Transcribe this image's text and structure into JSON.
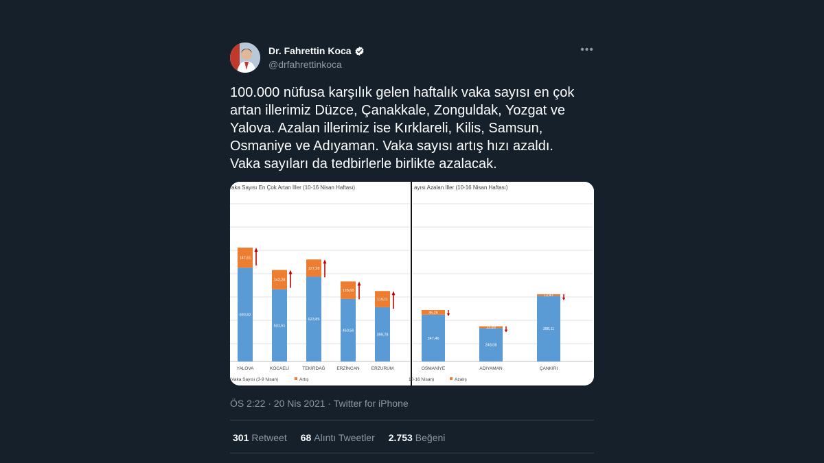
{
  "author": {
    "name": "Dr. Fahrettin Koca",
    "handle": "@drfahrettinkoca"
  },
  "tweet_text": "100.000 nüfusa karşılık gelen haftalık vaka sayısı en çok\nartan illerimiz Düzce, Çanakkale, Zonguldak, Yozgat ve\nYalova. Azalan illerimiz ise Kırklareli, Kilis, Samsun,\nOsmaniye ve Adıyaman. Vaka sayısı artış hızı azaldı.\nVaka sayıları da tedbirlerle birlikte azalacak.",
  "meta": "ÖS 2:22 · 20 Nis 2021 · Twitter for iPhone",
  "stats": {
    "retweets_count": "301",
    "retweets_label": "Retweet",
    "quotes_count": "68",
    "quotes_label": "Alıntı Tweetler",
    "likes_count": "2.753",
    "likes_label": "Beğeni"
  },
  "colors": {
    "background": "#15202b",
    "base_bar": "#5b9bd5",
    "change_bar": "#ed7d31",
    "arrow": "#c00000"
  },
  "icons": {
    "verified": "verified-badge-icon",
    "more": "more-options-icon"
  },
  "chart_data": [
    {
      "type": "bar",
      "stacked": true,
      "title": "aka Sayısı En Çok Artan İller (10-16 Nisan Haftası)",
      "categories": [
        "YALOVA",
        "KOCAELİ",
        "TEKİRDAĞ",
        "ERZİNCAN",
        "ERZURUM"
      ],
      "series": [
        {
          "name": "Vaka Sayısı (3-9 Nisan)",
          "values": [
            690.82,
            531.51,
            623.85,
            460.56,
            399.78
          ],
          "labels": [
            "690,82",
            "531,51",
            "623,85",
            "460,56",
            "399,78"
          ]
        },
        {
          "name": "Artış",
          "values": [
            147.61,
            142.28,
            127.28,
            128.68,
            119.11
          ],
          "labels": [
            "147,61",
            "142,28",
            "127,28",
            "128,68",
            "119,11"
          ]
        }
      ],
      "legend": "bottom-left",
      "grid": true
    },
    {
      "type": "bar",
      "stacked": true,
      "title": "ayısı Azalan İller (10-16 Nisan Haftası)",
      "categories": [
        "OSMANİYE",
        "ADIYAMAN",
        "ÇANKIRI"
      ],
      "series": [
        {
          "name": "10-16 Nisan)",
          "values": [
            347.46,
            248.08,
            488.11
          ],
          "labels": [
            "347,46",
            "248,08",
            "388,11"
          ]
        },
        {
          "name": "Azalış",
          "values": [
            35.26,
            13.83,
            12.47
          ],
          "labels": [
            "35,26",
            "13,83",
            "12,47"
          ]
        }
      ],
      "legend": "bottom-left",
      "grid": true
    }
  ]
}
